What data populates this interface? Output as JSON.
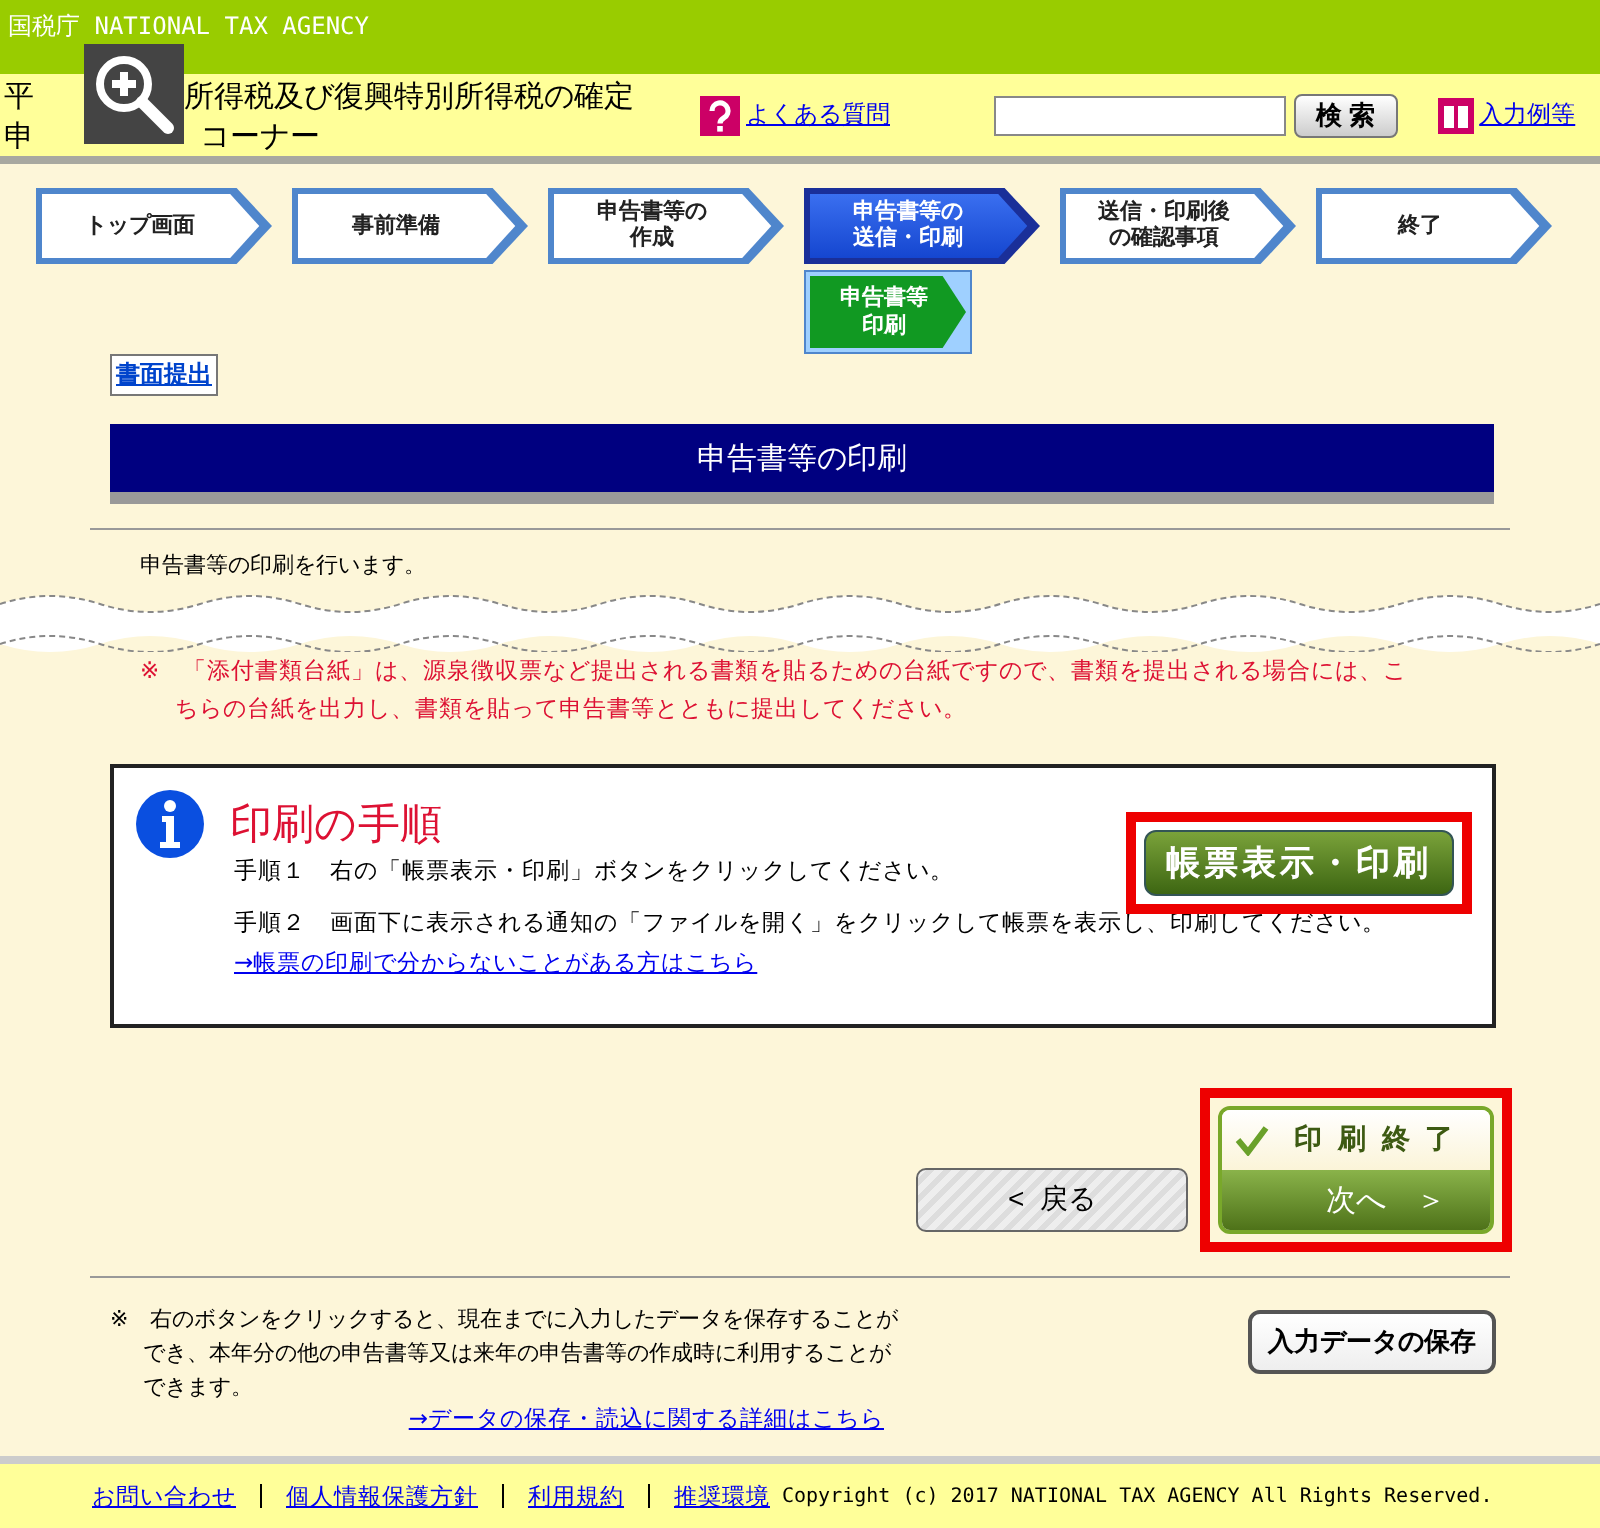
{
  "agency_bar": {
    "title": "国税庁 NATIONAL TAX AGENCY"
  },
  "header": {
    "title_line1_start": "平",
    "title_line1_end": "所得税及び復興特別所得税の確定",
    "title_line2_start": "申",
    "title_line2_end": "コーナー",
    "faq_link": "よくある質問",
    "search": {
      "button": "検 索"
    },
    "examples_link": "入力例等"
  },
  "steps": [
    {
      "lines": [
        "トップ画面"
      ],
      "selected": false
    },
    {
      "lines": [
        "事前準備"
      ],
      "selected": false
    },
    {
      "lines": [
        "申告書等の",
        "作成"
      ],
      "selected": false
    },
    {
      "lines": [
        "申告書等の",
        "送信・印刷"
      ],
      "selected": true
    },
    {
      "lines": [
        "送信・印刷後",
        "の確認事項"
      ],
      "selected": false
    },
    {
      "lines": [
        "終了"
      ],
      "selected": false
    }
  ],
  "substep": {
    "lines": [
      "申告書等",
      "印刷"
    ],
    "selected": true
  },
  "paper_submit_button": "書面提出",
  "page_title": "申告書等の印刷",
  "intro": "申告書等の印刷を行います。",
  "notice": "※　「添付書類台紙」は、源泉徴収票など提出される書類を貼るための台紙ですので、書類を提出される場合には、こちらの台紙を出力し、書類を貼って申告書等とともに提出してください。",
  "procedure": {
    "heading": "印刷の手順",
    "print_button": "帳票表示・印刷",
    "steps": [
      "手順１　右の「帳票表示・印刷」ボタンをクリックしてください。",
      "手順２　画面下に表示される通知の「ファイルを開く」をクリックして帳票を表示し、印刷してください。"
    ],
    "help_link": "→帳票の印刷で分からないことがある方はこちら"
  },
  "back_button": "<  戻る",
  "finish_button": {
    "top": "印 刷 終 了",
    "bottom": "次へ　＞"
  },
  "save_note": "※　右のボタンをクリックすると、現在までに入力したデータを保存することができ、本年分の他の申告書等又は来年の申告書等の作成時に利用することができます。",
  "save_link": "→データの保存・読込に関する詳細はこちら",
  "save_button": "入力データの保存",
  "footer": {
    "links": [
      "お問い合わせ",
      "個人情報保護方針",
      "利用規約",
      "推奨環境"
    ],
    "copyright": "Copyright (c) 2017 NATIONAL TAX AGENCY All Rights Reserved."
  }
}
